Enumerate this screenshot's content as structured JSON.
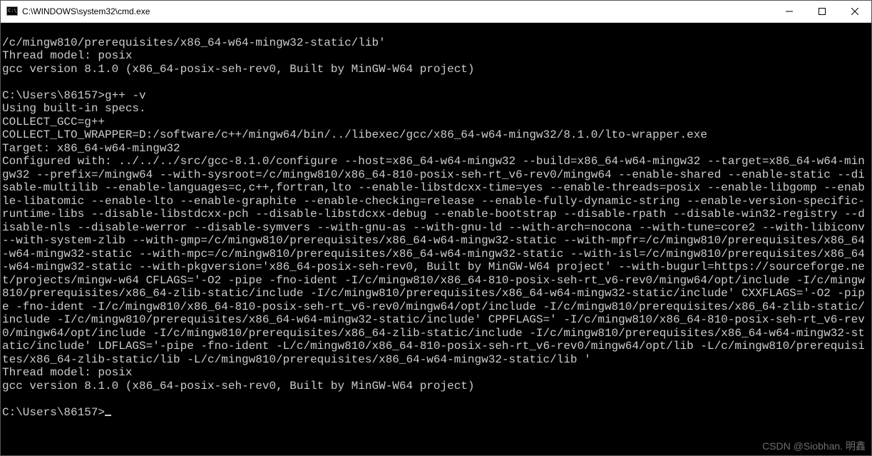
{
  "window": {
    "title": "C:\\WINDOWS\\system32\\cmd.exe"
  },
  "prompt": {
    "path": "C:\\Users\\86157",
    "command1": "g++ -v",
    "command2": ""
  },
  "output": {
    "head_line1": "/c/mingw810/prerequisites/x86_64-w64-mingw32-static/lib'",
    "head_line2": "Thread model: posix",
    "head_line3": "gcc version 8.1.0 (x86_64-posix-seh-rev0, Built by MinGW-W64 project)",
    "spec_line": "Using built-in specs.",
    "collect_gcc": "COLLECT_GCC=g++",
    "collect_lto": "COLLECT_LTO_WRAPPER=D:/software/c++/mingw64/bin/../libexec/gcc/x86_64-w64-mingw32/8.1.0/lto-wrapper.exe",
    "target": "Target: x86_64-w64-mingw32",
    "configured": "Configured with: ../../../src/gcc-8.1.0/configure --host=x86_64-w64-mingw32 --build=x86_64-w64-mingw32 --target=x86_64-w64-mingw32 --prefix=/mingw64 --with-sysroot=/c/mingw810/x86_64-810-posix-seh-rt_v6-rev0/mingw64 --enable-shared --enable-static --disable-multilib --enable-languages=c,c++,fortran,lto --enable-libstdcxx-time=yes --enable-threads=posix --enable-libgomp --enable-libatomic --enable-lto --enable-graphite --enable-checking=release --enable-fully-dynamic-string --enable-version-specific-runtime-libs --disable-libstdcxx-pch --disable-libstdcxx-debug --enable-bootstrap --disable-rpath --disable-win32-registry --disable-nls --disable-werror --disable-symvers --with-gnu-as --with-gnu-ld --with-arch=nocona --with-tune=core2 --with-libiconv --with-system-zlib --with-gmp=/c/mingw810/prerequisites/x86_64-w64-mingw32-static --with-mpfr=/c/mingw810/prerequisites/x86_64-w64-mingw32-static --with-mpc=/c/mingw810/prerequisites/x86_64-w64-mingw32-static --with-isl=/c/mingw810/prerequisites/x86_64-w64-mingw32-static --with-pkgversion='x86_64-posix-seh-rev0, Built by MinGW-W64 project' --with-bugurl=https://sourceforge.net/projects/mingw-w64 CFLAGS='-O2 -pipe -fno-ident -I/c/mingw810/x86_64-810-posix-seh-rt_v6-rev0/mingw64/opt/include -I/c/mingw810/prerequisites/x86_64-zlib-static/include -I/c/mingw810/prerequisites/x86_64-w64-mingw32-static/include' CXXFLAGS='-O2 -pipe -fno-ident -I/c/mingw810/x86_64-810-posix-seh-rt_v6-rev0/mingw64/opt/include -I/c/mingw810/prerequisites/x86_64-zlib-static/include -I/c/mingw810/prerequisites/x86_64-w64-mingw32-static/include' CPPFLAGS=' -I/c/mingw810/x86_64-810-posix-seh-rt_v6-rev0/mingw64/opt/include -I/c/mingw810/prerequisites/x86_64-zlib-static/include -I/c/mingw810/prerequisites/x86_64-w64-mingw32-static/include' LDFLAGS='-pipe -fno-ident -L/c/mingw810/x86_64-810-posix-seh-rt_v6-rev0/mingw64/opt/lib -L/c/mingw810/prerequisites/x86_64-zlib-static/lib -L/c/mingw810/prerequisites/x86_64-w64-mingw32-static/lib '",
    "thread_model": "Thread model: posix",
    "gcc_version": "gcc version 8.1.0 (x86_64-posix-seh-rev0, Built by MinGW-W64 project)"
  },
  "watermark": "CSDN @Siobhan. 明鑫"
}
